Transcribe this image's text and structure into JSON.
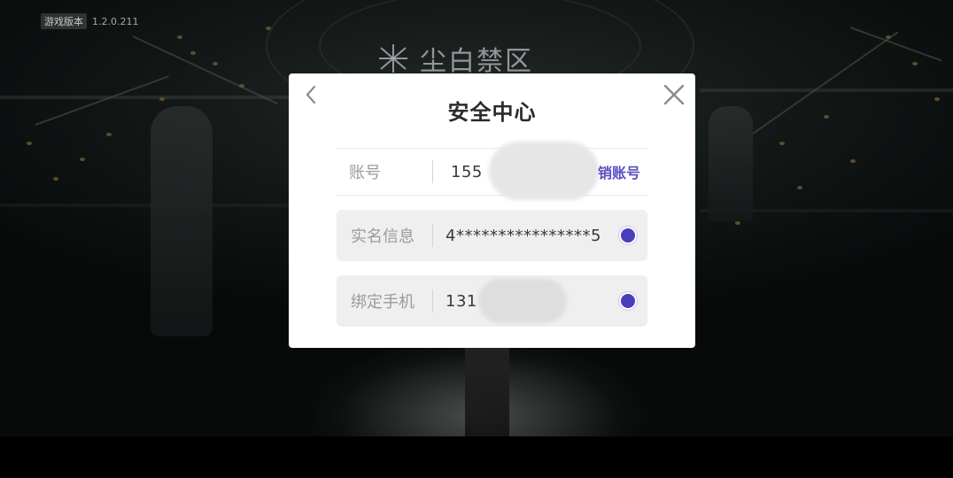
{
  "app": {
    "version_tag": "游戏版本",
    "version_number": "1.2.0.211",
    "logo_text": "尘白禁区"
  },
  "modal": {
    "title": "安全中心",
    "back_icon": "chevron-left-icon",
    "close_icon": "close-icon",
    "rows": {
      "account": {
        "label": "账号",
        "value": "155",
        "action": "销账号"
      },
      "realname": {
        "label": "实名信息",
        "value": "4****************5",
        "status_icon": "radio-dot-icon"
      },
      "phone": {
        "label": "绑定手机",
        "value": "131",
        "status_icon": "radio-dot-icon"
      }
    }
  },
  "colors": {
    "accent": "#4a3fb8",
    "link": "#5a4fc2",
    "modal_bg": "#ffffff",
    "row_bg": "#efefef"
  }
}
